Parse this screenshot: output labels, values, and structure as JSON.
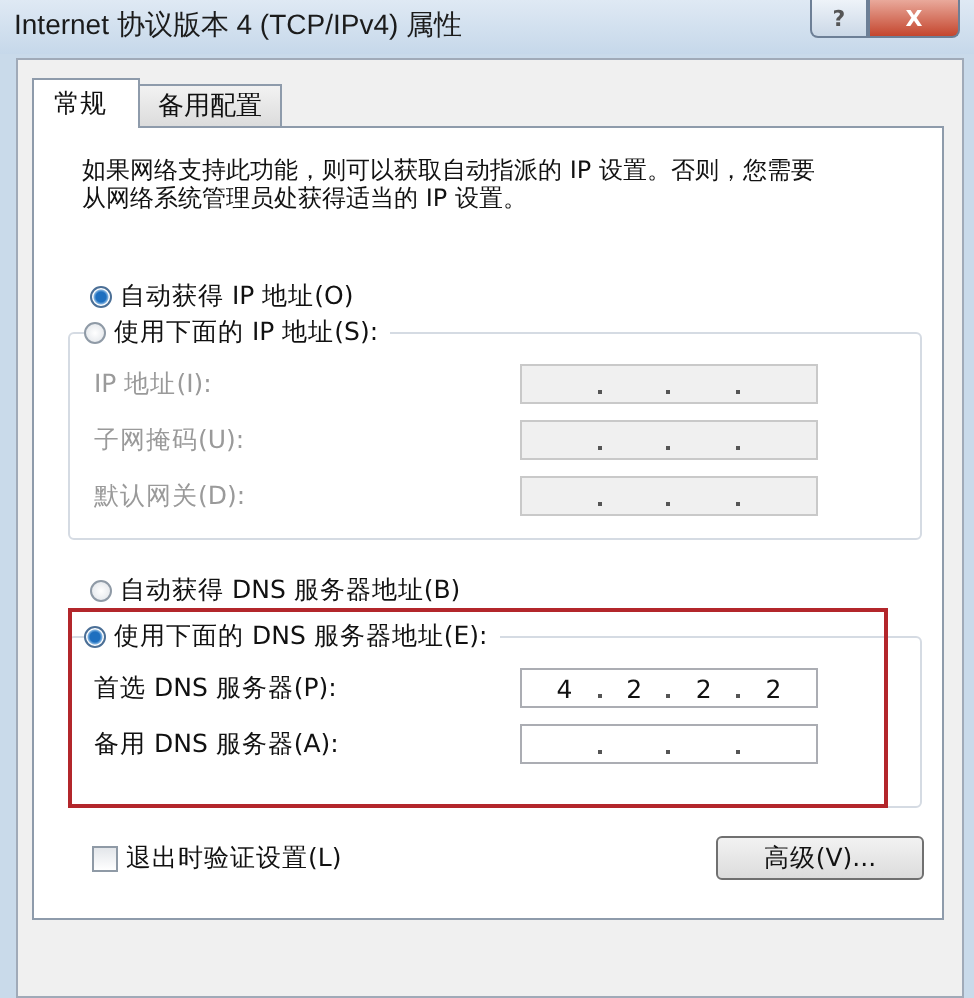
{
  "window": {
    "title": "Internet 协议版本 4 (TCP/IPv4) 属性",
    "help_button": "?",
    "close_button": "X"
  },
  "tabs": [
    {
      "label": "常规",
      "selected": true
    },
    {
      "label": "备用配置",
      "selected": false
    }
  ],
  "description": "如果网络支持此功能，则可以获取自动指派的 IP 设置。否则，您需要从网络系统管理员处获得适当的 IP 设置。",
  "ip_mode": [
    {
      "label": "自动获得 IP 地址(O)",
      "selected": true
    },
    {
      "label": "使用下面的 IP 地址(S):",
      "selected": false
    }
  ],
  "ip_fields": {
    "disabled": true,
    "rows": [
      {
        "label": "IP 地址(I):"
      },
      {
        "label": "子网掩码(U):"
      },
      {
        "label": "默认网关(D):"
      }
    ]
  },
  "dns_mode": [
    {
      "label": "自动获得 DNS 服务器地址(B)",
      "selected": false
    },
    {
      "label": "使用下面的 DNS 服务器地址(E):",
      "selected": true
    }
  ],
  "dns_fields": {
    "disabled": false,
    "rows": [
      {
        "label": "首选 DNS 服务器(P):",
        "octets": [
          "4",
          "2",
          "2",
          "2"
        ]
      },
      {
        "label": "备用 DNS 服务器(A):"
      }
    ]
  },
  "validate_on_exit": {
    "label": "退出时验证设置(L)",
    "checked": false
  },
  "advanced_button": "高级(V)..."
}
